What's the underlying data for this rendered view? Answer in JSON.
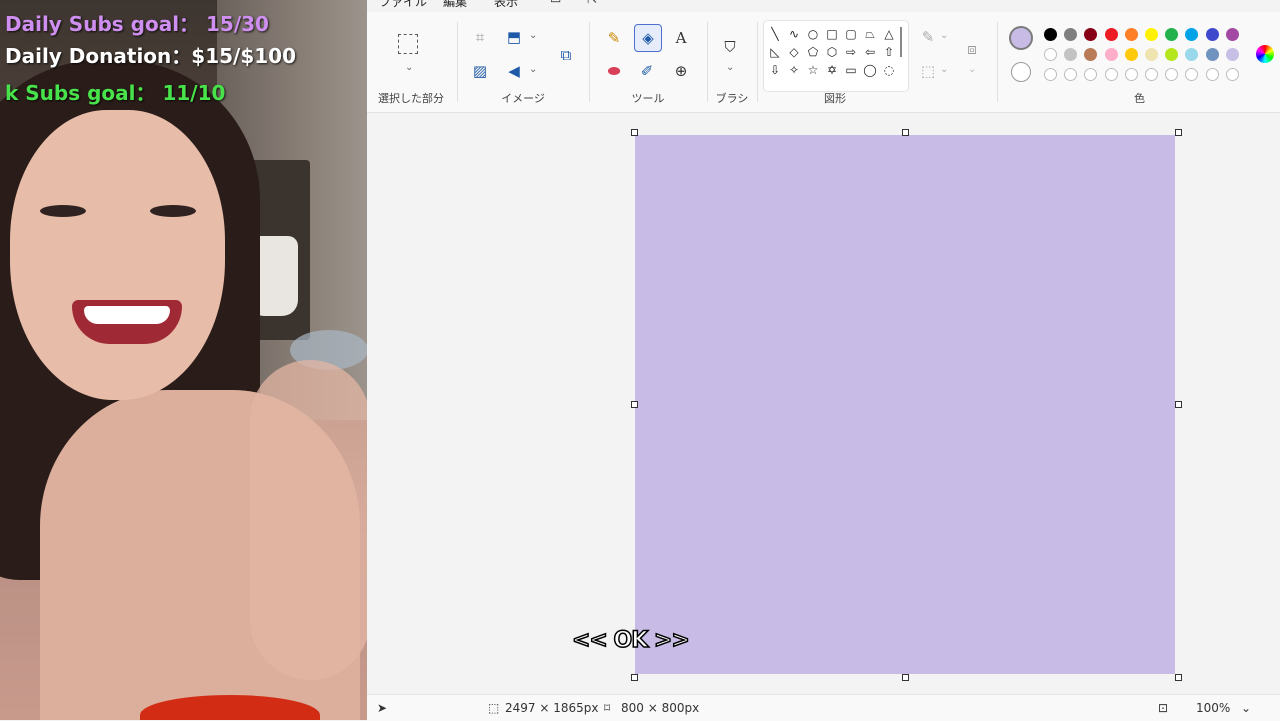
{
  "stream_overlay": {
    "daily_subs_goal": "Daily Subs goal： 15/30",
    "daily_donation": "Daily Donation：$15/$100",
    "k_subs_goal": "k Subs goal： 11/10"
  },
  "menu": [
    "ファイル",
    "編集",
    "表示"
  ],
  "ribbon": {
    "groups": {
      "selection": "選択した部分",
      "image": "イメージ",
      "tools": "ツール",
      "brushes": "ブラシ",
      "shapes": "図形",
      "colors": "色"
    },
    "active_tool": "fill-bucket",
    "current_color": "#c8bce6",
    "palette_row1": [
      "#000000",
      "#7f7f7f",
      "#880015",
      "#ed1c24",
      "#ff7f27",
      "#fff200",
      "#22b14c",
      "#00a2e8",
      "#3f48cc",
      "#a349a4"
    ],
    "palette_row2": [
      "#ffffff",
      "#c3c3c3",
      "#b97a57",
      "#ffaec9",
      "#ffc90e",
      "#efe4b0",
      "#b5e61d",
      "#99d9ea",
      "#7092be",
      "#c8bfe7"
    ]
  },
  "canvas": {
    "fill_color": "#c8bce6"
  },
  "status": {
    "cursor_position": "",
    "selection_size": "2497 × 1865px",
    "canvas_size": "800 × 800px",
    "zoom": "100%"
  },
  "caption": "<< OK >>"
}
